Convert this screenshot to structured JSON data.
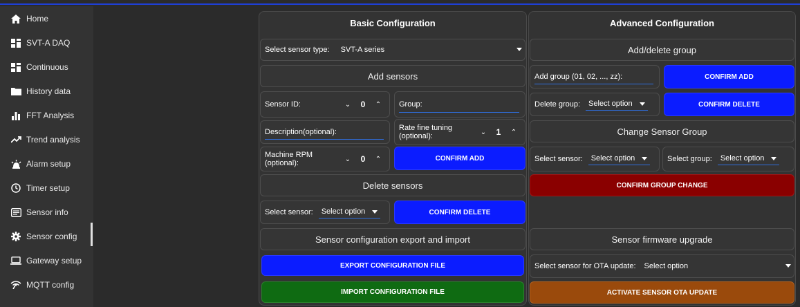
{
  "sidebar": {
    "items": [
      {
        "label": "Home",
        "icon": "home-icon"
      },
      {
        "label": "SVT-A DAQ",
        "icon": "dashboard-icon"
      },
      {
        "label": "Continuous",
        "icon": "dashboard-icon"
      },
      {
        "label": "History data",
        "icon": "folder-icon"
      },
      {
        "label": "FFT Analysis",
        "icon": "bar-chart-icon"
      },
      {
        "label": "Trend analysis",
        "icon": "trend-icon"
      },
      {
        "label": "Alarm setup",
        "icon": "alarm-icon"
      },
      {
        "label": "Timer setup",
        "icon": "clock-icon"
      },
      {
        "label": "Sensor info",
        "icon": "info-card-icon"
      },
      {
        "label": "Sensor config",
        "icon": "gear-icon"
      },
      {
        "label": "Gateway setup",
        "icon": "laptop-icon"
      },
      {
        "label": "MQTT config",
        "icon": "broadcast-icon"
      }
    ],
    "active": "Sensor config"
  },
  "basic": {
    "title": "Basic Configuration",
    "sensor_type_label": "Select sensor type:",
    "sensor_type_value": "SVT-A series",
    "add_sensors_title": "Add sensors",
    "sensor_id_label": "Sensor ID:",
    "sensor_id_value": "0",
    "group_placeholder": "Group:",
    "description_placeholder": "Description(optional):",
    "rate_label": "Rate fine tuning (optional):",
    "rate_value": "1",
    "rpm_label": "Machine RPM (optional):",
    "rpm_value": "0",
    "confirm_add": "CONFIRM ADD",
    "delete_sensors_title": "Delete sensors",
    "select_sensor_label": "Select sensor:",
    "select_sensor_value": "Select option",
    "confirm_delete": "CONFIRM DELETE",
    "export_import_title": "Sensor configuration export and import",
    "export_button": "EXPORT CONFIGURATION FILE",
    "import_button": "IMPORT CONFIGURATION FILE"
  },
  "advanced": {
    "title": "Advanced Configuration",
    "add_delete_group_title": "Add/delete group",
    "add_group_placeholder": "Add group (01, 02, ..., zz):",
    "confirm_add": "CONFIRM ADD",
    "delete_group_label": "Delete group:",
    "delete_group_value": "Select option",
    "confirm_delete": "CONFIRM DELETE",
    "change_group_title": "Change Sensor Group",
    "select_sensor_label": "Select sensor:",
    "select_sensor_value": "Select option",
    "select_group_label": "Select group:",
    "select_group_value": "Select option",
    "confirm_group_change": "CONFIRM GROUP CHANGE",
    "firmware_title": "Sensor firmware upgrade",
    "ota_label": "Select sensor for OTA update:",
    "ota_value": "Select option",
    "activate_ota": "ACTIVATE SENSOR OTA UPDATE"
  },
  "colors": {
    "primary_button": "#0b1cff",
    "import_button": "#0f6b12",
    "group_change_button": "#8a0000",
    "ota_button": "#9a4a0c",
    "top_accent": "#1e3fd6"
  }
}
